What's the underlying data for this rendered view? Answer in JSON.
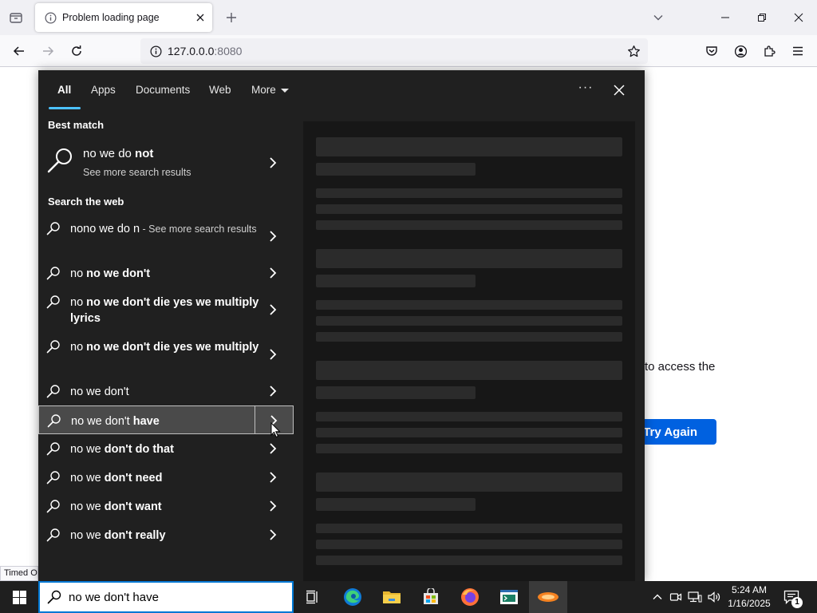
{
  "browser": {
    "tab_title": "Problem loading page",
    "url": "127.0.0.0:8080",
    "url_host": "127.0.0.0",
    "url_port": ":8080"
  },
  "page": {
    "message_fragment": "to access the",
    "try_again_label": "Try Again",
    "status_text": "Timed Out"
  },
  "search": {
    "tabs": [
      "All",
      "Apps",
      "Documents",
      "Web",
      "More"
    ],
    "best_match_header": "Best match",
    "best_match": {
      "title_plain": "no we do ",
      "title_bold": "not",
      "subtitle": "See more search results"
    },
    "web_header": "Search the web",
    "web_results": [
      {
        "plain": "nono we do n",
        "bold": "",
        "suffix": " - See more search results"
      },
      {
        "plain": "no ",
        "bold": "no we don't",
        "suffix": ""
      },
      {
        "plain": "no ",
        "bold": "no we don't die yes we multiply lyrics",
        "suffix": ""
      },
      {
        "plain": "no ",
        "bold": "no we don't die yes we multiply",
        "suffix": ""
      },
      {
        "plain": "no we don't",
        "bold": "",
        "suffix": ""
      },
      {
        "plain": "no we don't ",
        "bold": "have",
        "suffix": ""
      },
      {
        "plain": "no we ",
        "bold": "don't do that",
        "suffix": ""
      },
      {
        "plain": "no we ",
        "bold": "don't need",
        "suffix": ""
      },
      {
        "plain": "no we ",
        "bold": "don't want",
        "suffix": ""
      },
      {
        "plain": "no we ",
        "bold": "don't really",
        "suffix": ""
      }
    ],
    "query": "no we don't have"
  },
  "taskbar": {
    "time": "5:24 AM",
    "date": "1/16/2025",
    "notification_count": "1",
    "apps": [
      "task-view-icon",
      "edge-icon",
      "file-explorer-icon",
      "store-icon",
      "firefox-icon",
      "terminal-icon",
      "app-icon"
    ]
  },
  "colors": {
    "accent": "#0078d4",
    "try_again": "#0061e0",
    "search_underline": "#4cc2ff"
  }
}
